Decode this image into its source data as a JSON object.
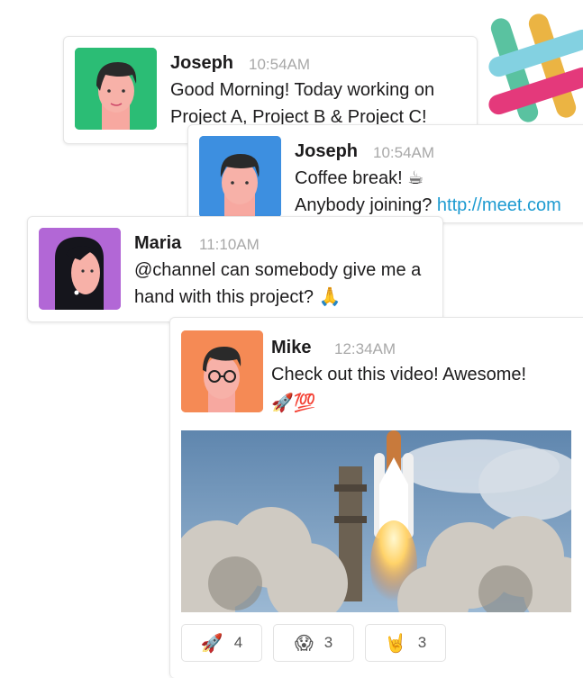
{
  "messages": [
    {
      "author": "Joseph",
      "time": "10:54AM",
      "lines": [
        "Good Morning! Today working on",
        "Project A, Project B & Project C!"
      ],
      "avatar_color": "#2bbd75"
    },
    {
      "author": "Joseph",
      "time": "10:54AM",
      "lines": [
        "Coffee break! ☕",
        "Anybody joining? "
      ],
      "link": "http://meet.com",
      "avatar_color": "#3d8fe0"
    },
    {
      "author": "Maria",
      "time": "11:10AM",
      "lines": [
        "@channel can somebody give me a",
        "hand with this project? 🙏"
      ],
      "avatar_color": "#b267d6"
    },
    {
      "author": "Mike",
      "time": "12:34AM",
      "lines": [
        "Check out this video! Awesome!",
        "🚀💯"
      ],
      "avatar_color": "#f58a55"
    }
  ],
  "reactions": [
    {
      "emoji": "🚀",
      "count": "4"
    },
    {
      "emoji": "😱",
      "count": "3"
    },
    {
      "emoji": "🤘",
      "count": "3"
    }
  ],
  "colors": {
    "link": "#1d9bd1",
    "time": "#a8a8a8",
    "logo": [
      "#3eb890",
      "#e01765",
      "#e8a723",
      "#6ecadc"
    ]
  },
  "icons": {
    "logo": "slack-hash-logo",
    "video": "rocket-launch-photo"
  }
}
